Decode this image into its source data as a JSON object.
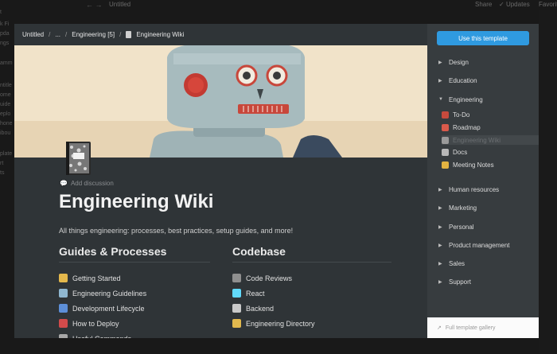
{
  "background": {
    "title": "Untitled",
    "share": "Share",
    "updates": "Updates",
    "favorite": "Favorite",
    "sidebar_fragments": [
      "t",
      "k Fi",
      "pda",
      "ngs",
      "",
      "amm",
      "",
      "ntitle",
      "ome",
      "uide",
      "eplo",
      "hone",
      "ibou",
      "",
      "plate",
      "rt",
      "ts"
    ]
  },
  "breadcrumb": [
    "Untitled",
    "...",
    "Engineering [5]",
    "Engineering Wiki"
  ],
  "page": {
    "add_discussion": "Add discussion",
    "title": "Engineering Wiki",
    "description": "All things engineering: processes, best practices, setup guides, and more!"
  },
  "columns": [
    {
      "heading": "Guides & Processes",
      "links": [
        {
          "label": "Getting Started",
          "icon": "rocket-icon",
          "color": "#e4b84c"
        },
        {
          "label": "Engineering Guidelines",
          "icon": "robot-icon",
          "color": "#8fb7d0"
        },
        {
          "label": "Development Lifecycle",
          "icon": "cycle-icon",
          "color": "#5d8fd8"
        },
        {
          "label": "How to Deploy",
          "icon": "flag-icon",
          "color": "#d24b4b"
        },
        {
          "label": "Useful Commands",
          "icon": "tools-icon",
          "color": "#a8a8a8"
        }
      ]
    },
    {
      "heading": "Codebase",
      "links": [
        {
          "label": "Code Reviews",
          "icon": "check-icon",
          "color": "#8f8f8f"
        },
        {
          "label": "React",
          "icon": "atom-icon",
          "color": "#61dafb"
        },
        {
          "label": "Backend",
          "icon": "computer-icon",
          "color": "#c9c9c9"
        },
        {
          "label": "Engineering Directory",
          "icon": "folder-icon",
          "color": "#e2b94e"
        }
      ]
    }
  ],
  "sidebar": {
    "use_template": "Use this template",
    "categories_top": [
      {
        "label": "Design",
        "expanded": false
      },
      {
        "label": "Education",
        "expanded": false
      },
      {
        "label": "Engineering",
        "expanded": true
      }
    ],
    "sub_items": [
      {
        "label": "To-Do",
        "icon": "todo-icon",
        "color": "#c64a3d"
      },
      {
        "label": "Roadmap",
        "icon": "roadmap-icon",
        "color": "#d95a4b"
      },
      {
        "label": "Engineering Wiki",
        "icon": "notebook-icon",
        "color": "#9a9a9a",
        "selected": true
      },
      {
        "label": "Docs",
        "icon": "paperclip-icon",
        "color": "#b8b8b8"
      },
      {
        "label": "Meeting Notes",
        "icon": "pencil-icon",
        "color": "#e3b341"
      }
    ],
    "categories_bottom": [
      {
        "label": "Human resources",
        "expanded": false
      },
      {
        "label": "Marketing",
        "expanded": false
      },
      {
        "label": "Personal",
        "expanded": false
      },
      {
        "label": "Product management",
        "expanded": false
      },
      {
        "label": "Sales",
        "expanded": false
      },
      {
        "label": "Support",
        "expanded": false
      }
    ],
    "footer": "Full template gallery"
  }
}
